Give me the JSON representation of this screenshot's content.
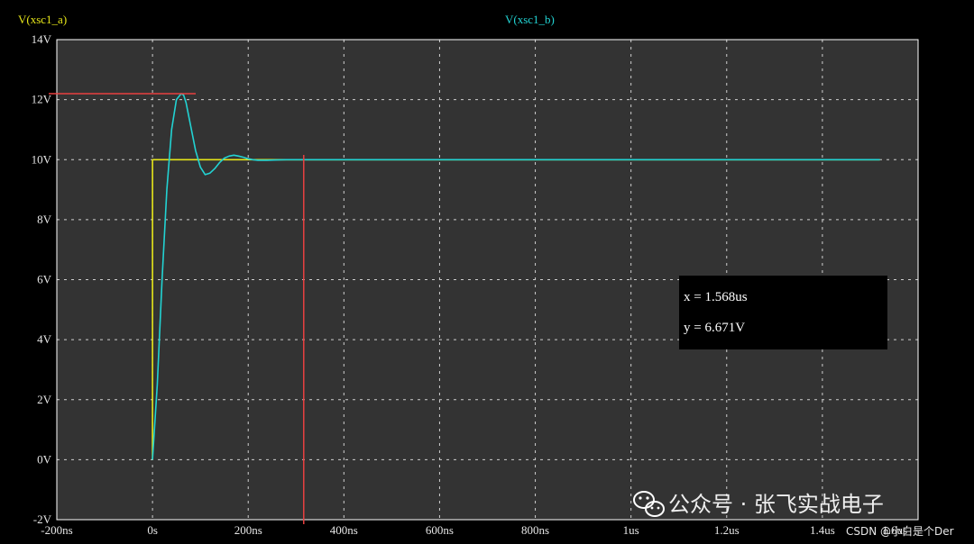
{
  "chart_data": {
    "type": "line",
    "title": "",
    "xlabel": "",
    "ylabel": "",
    "xlim": [
      -200,
      1600
    ],
    "ylim": [
      -2,
      14
    ],
    "x_unit": "ns",
    "x_ticks": [
      {
        "value": -200,
        "label": "-200ns"
      },
      {
        "value": 0,
        "label": "0s"
      },
      {
        "value": 200,
        "label": "200ns"
      },
      {
        "value": 400,
        "label": "400ns"
      },
      {
        "value": 600,
        "label": "600ns"
      },
      {
        "value": 800,
        "label": "800ns"
      },
      {
        "value": 1000,
        "label": "1us"
      },
      {
        "value": 1200,
        "label": "1.2us"
      },
      {
        "value": 1400,
        "label": "1.4us"
      },
      {
        "value": 1600,
        "label": "1.6us"
      }
    ],
    "y_ticks": [
      {
        "value": -2,
        "label": "-2V"
      },
      {
        "value": 0,
        "label": "0V"
      },
      {
        "value": 2,
        "label": "2V"
      },
      {
        "value": 4,
        "label": "4V"
      },
      {
        "value": 6,
        "label": "6V"
      },
      {
        "value": 8,
        "label": "8V"
      },
      {
        "value": 10,
        "label": "10V"
      },
      {
        "value": 12,
        "label": "12V"
      },
      {
        "value": 14,
        "label": "14V"
      }
    ],
    "grid": true,
    "series": [
      {
        "name": "V(xsc1_a)",
        "color": "#e6e619",
        "x": [
          0,
          0,
          1520
        ],
        "y": [
          0,
          10,
          10
        ]
      },
      {
        "name": "V(xsc1_b)",
        "color": "#22d3d3",
        "x": [
          0,
          10,
          20,
          30,
          40,
          50,
          60,
          65,
          70,
          80,
          90,
          100,
          110,
          120,
          130,
          140,
          150,
          160,
          170,
          180,
          190,
          200,
          210,
          220,
          240,
          260,
          280,
          300,
          340,
          400,
          600,
          800,
          1000,
          1200,
          1400,
          1520
        ],
        "y": [
          0,
          2.5,
          6.0,
          9.0,
          11.0,
          12.0,
          12.2,
          12.15,
          11.9,
          11.1,
          10.3,
          9.75,
          9.5,
          9.55,
          9.7,
          9.9,
          10.05,
          10.12,
          10.15,
          10.12,
          10.08,
          10.03,
          10.0,
          9.98,
          9.98,
          9.99,
          10.0,
          10.0,
          10.0,
          10.0,
          10.0,
          10.0,
          10.0,
          10.0,
          10.0,
          10.0
        ]
      }
    ],
    "cursors": {
      "color": "#e84040",
      "vertical_x": 316,
      "horizontal_y": 12.2
    },
    "readout": {
      "x_text": "x = 1.568us",
      "y_text": "y = 6.671V"
    }
  },
  "watermark": {
    "text": "公众号 · 张飞实战电子",
    "icon": "wechat-icon",
    "credit": "CSDN @小白是个Der"
  },
  "colors": {
    "background": "#000000",
    "plot_area": "#333333",
    "grid": "#cfcfcf",
    "border": "#ffffff"
  }
}
